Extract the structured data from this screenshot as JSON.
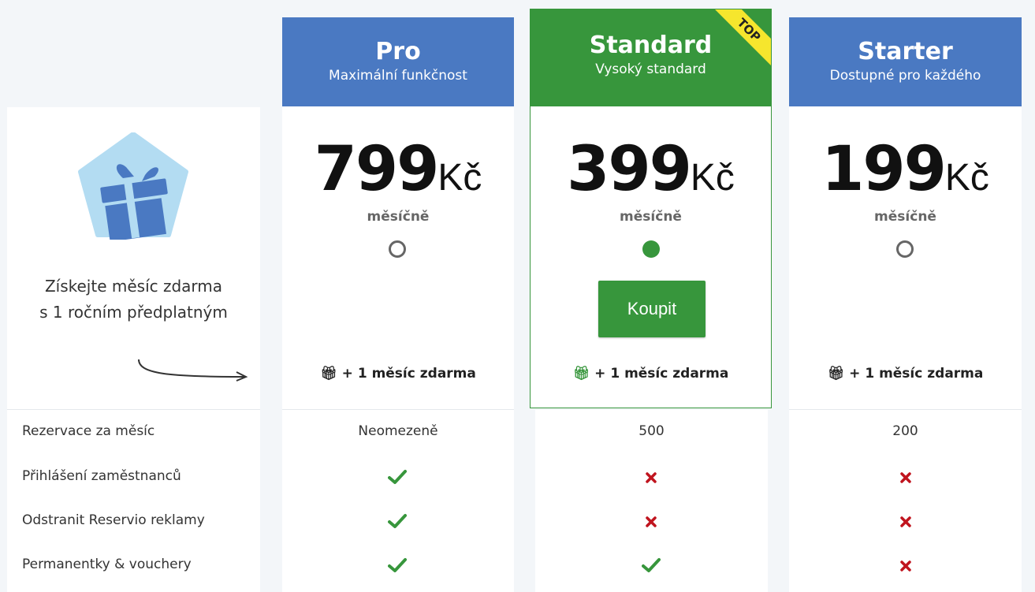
{
  "promo": {
    "line1": "Získejte měsíc zdarma",
    "line2": "s 1 ročním předplatným"
  },
  "colors": {
    "blue": "#4a79c2",
    "green": "#37963c",
    "ribbon": "#f6e62d",
    "cross": "#c0141e"
  },
  "top_badge": "TOP",
  "plans": [
    {
      "name": "Pro",
      "subtitle": "Maximální funkčnost",
      "price": "799",
      "currency": "Kč",
      "period": "měsíčně",
      "selected": false,
      "bonus": "+ 1 měsíc zdarma"
    },
    {
      "name": "Standard",
      "subtitle": "Vysoký standard",
      "price": "399",
      "currency": "Kč",
      "period": "měsíčně",
      "selected": true,
      "bonus": "+ 1 měsíc zdarma",
      "buy_label": "Koupit"
    },
    {
      "name": "Starter",
      "subtitle": "Dostupné pro každého",
      "price": "199",
      "currency": "Kč",
      "period": "měsíčně",
      "selected": false,
      "bonus": "+ 1 měsíc zdarma"
    }
  ],
  "features": [
    {
      "label": "Rezervace za měsíc",
      "values": [
        "Neomezeně",
        "500",
        "200"
      ]
    },
    {
      "label": "Přihlášení zaměstnanců",
      "values": [
        "check-icon",
        "cross-icon",
        "cross-icon"
      ]
    },
    {
      "label": "Odstranit Reservio reklamy",
      "values": [
        "check-icon",
        "cross-icon",
        "cross-icon"
      ]
    },
    {
      "label": "Permanentky & vouchery",
      "values": [
        "check-icon",
        "check-icon",
        "cross-icon"
      ]
    }
  ]
}
